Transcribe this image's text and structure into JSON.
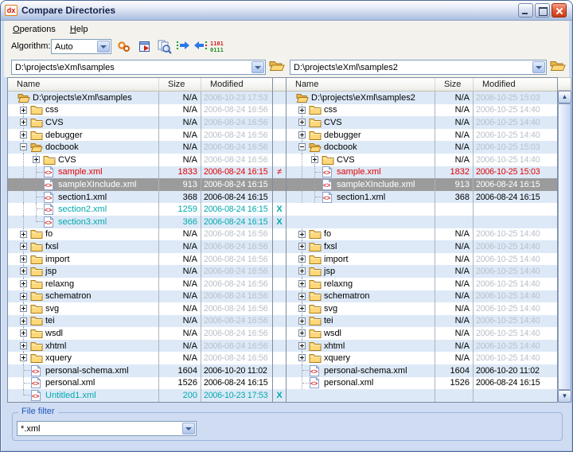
{
  "window": {
    "title": "Compare Directories",
    "icon_text": "dx"
  },
  "menu": {
    "items": [
      "Operations",
      "Help"
    ]
  },
  "toolbar": {
    "algorithm_label": "Algorithm:",
    "algorithm_value": "Auto",
    "icons": [
      "algorithm-options-gears-icon",
      "synchronize-scroll-icon",
      "perform-files-comparison-icon",
      "copy-to-right-icon",
      "copy-to-left-icon",
      "binary-compare-icon"
    ]
  },
  "paths": {
    "left": "D:\\projects\\eXml\\samples",
    "right": "D:\\projects\\eXml\\samples2"
  },
  "columns": [
    "Name",
    "Size",
    "Modified"
  ],
  "rows": [
    {
      "marker": "",
      "cls": "",
      "left": {
        "name": "D:\\projects\\eXml\\samples",
        "size": "N/A",
        "mod": "2006-10-23 17:53",
        "icon": "folder-open",
        "guides": []
      },
      "right": {
        "name": "D:\\projects\\eXml\\samples2",
        "size": "N/A",
        "mod": "2006-10-25 15:03",
        "icon": "folder-open",
        "guides": []
      }
    },
    {
      "marker": "",
      "cls": "",
      "left": {
        "name": "css",
        "size": "N/A",
        "mod": "2006-08-24 16:56",
        "icon": "folder",
        "exp": "+",
        "guides": [
          "boxline"
        ]
      },
      "right": {
        "name": "css",
        "size": "N/A",
        "mod": "2006-10-25 14:40",
        "icon": "folder",
        "exp": "+",
        "guides": [
          "boxline"
        ]
      }
    },
    {
      "marker": "",
      "cls": "",
      "left": {
        "name": "CVS",
        "size": "N/A",
        "mod": "2006-08-24 16:56",
        "icon": "folder",
        "exp": "+",
        "guides": [
          "boxline"
        ]
      },
      "right": {
        "name": "CVS",
        "size": "N/A",
        "mod": "2006-10-25 14:40",
        "icon": "folder",
        "exp": "+",
        "guides": [
          "boxline"
        ]
      }
    },
    {
      "marker": "",
      "cls": "",
      "left": {
        "name": "debugger",
        "size": "N/A",
        "mod": "2006-08-24 16:56",
        "icon": "folder",
        "exp": "+",
        "guides": [
          "boxline"
        ]
      },
      "right": {
        "name": "debugger",
        "size": "N/A",
        "mod": "2006-10-25 14:40",
        "icon": "folder",
        "exp": "+",
        "guides": [
          "boxline"
        ]
      }
    },
    {
      "marker": "",
      "cls": "",
      "left": {
        "name": "docbook",
        "size": "N/A",
        "mod": "2006-08-24 16:56",
        "icon": "folder-open",
        "exp": "-",
        "guides": [
          "boxline"
        ]
      },
      "right": {
        "name": "docbook",
        "size": "N/A",
        "mod": "2006-10-25 15:03",
        "icon": "folder-open",
        "exp": "-",
        "guides": [
          "boxline"
        ]
      }
    },
    {
      "marker": "",
      "cls": "",
      "left": {
        "name": "CVS",
        "size": "N/A",
        "mod": "2006-08-24 16:56",
        "icon": "folder",
        "exp": "+",
        "guides": [
          "line",
          "boxline"
        ]
      },
      "right": {
        "name": "CVS",
        "size": "N/A",
        "mod": "2006-10-25 14:40",
        "icon": "folder",
        "exp": "+",
        "guides": [
          "line",
          "boxline"
        ]
      }
    },
    {
      "marker": "≠",
      "cls": "diff",
      "left": {
        "name": "sample.xml",
        "size": "1833",
        "mod": "2006-08-24 16:15",
        "icon": "xml",
        "guides": [
          "line",
          "stubline"
        ]
      },
      "right": {
        "name": "sample.xml",
        "size": "1832",
        "mod": "2006-10-25 15:03",
        "icon": "xml",
        "guides": [
          "line",
          "stubline"
        ]
      }
    },
    {
      "marker": "",
      "cls": "sel",
      "left": {
        "name": "sampleXInclude.xml",
        "size": "913",
        "mod": "2006-08-24 16:15",
        "icon": "xml",
        "guides": [
          "line",
          "stubline"
        ]
      },
      "right": {
        "name": "sampleXInclude.xml",
        "size": "913",
        "mod": "2006-08-24 16:15",
        "icon": "xml",
        "guides": [
          "line",
          "stubline"
        ]
      }
    },
    {
      "marker": "",
      "cls": "",
      "left": {
        "name": "section1.xml",
        "size": "368",
        "mod": "2006-08-24 16:15",
        "icon": "xml",
        "guides": [
          "line",
          "stubline"
        ]
      },
      "right": {
        "name": "section1.xml",
        "size": "368",
        "mod": "2006-08-24 16:15",
        "icon": "xml",
        "guides": [
          "line",
          "stubline"
        ]
      }
    },
    {
      "marker": "X",
      "cls": "add",
      "left": {
        "name": "section2.xml",
        "size": "1259",
        "mod": "2006-08-24 16:15",
        "icon": "xml",
        "guides": [
          "line",
          "stubline"
        ]
      },
      "right": null
    },
    {
      "marker": "X",
      "cls": "add",
      "left": {
        "name": "section3.xml",
        "size": "366",
        "mod": "2006-08-24 16:15",
        "icon": "xml",
        "guides": [
          "line",
          "stubend"
        ]
      },
      "right": null
    },
    {
      "marker": "",
      "cls": "",
      "left": {
        "name": "fo",
        "size": "N/A",
        "mod": "2006-08-24 16:56",
        "icon": "folder",
        "exp": "+",
        "guides": [
          "boxline"
        ]
      },
      "right": {
        "name": "fo",
        "size": "N/A",
        "mod": "2006-10-25 14:40",
        "icon": "folder",
        "exp": "+",
        "guides": [
          "boxline"
        ]
      }
    },
    {
      "marker": "",
      "cls": "",
      "left": {
        "name": "fxsl",
        "size": "N/A",
        "mod": "2006-08-24 16:56",
        "icon": "folder",
        "exp": "+",
        "guides": [
          "boxline"
        ]
      },
      "right": {
        "name": "fxsl",
        "size": "N/A",
        "mod": "2006-10-25 14:40",
        "icon": "folder",
        "exp": "+",
        "guides": [
          "boxline"
        ]
      }
    },
    {
      "marker": "",
      "cls": "",
      "left": {
        "name": "import",
        "size": "N/A",
        "mod": "2006-08-24 16:56",
        "icon": "folder",
        "exp": "+",
        "guides": [
          "boxline"
        ]
      },
      "right": {
        "name": "import",
        "size": "N/A",
        "mod": "2006-10-25 14:40",
        "icon": "folder",
        "exp": "+",
        "guides": [
          "boxline"
        ]
      }
    },
    {
      "marker": "",
      "cls": "",
      "left": {
        "name": "jsp",
        "size": "N/A",
        "mod": "2006-08-24 16:56",
        "icon": "folder",
        "exp": "+",
        "guides": [
          "boxline"
        ]
      },
      "right": {
        "name": "jsp",
        "size": "N/A",
        "mod": "2006-10-25 14:40",
        "icon": "folder",
        "exp": "+",
        "guides": [
          "boxline"
        ]
      }
    },
    {
      "marker": "",
      "cls": "",
      "left": {
        "name": "relaxng",
        "size": "N/A",
        "mod": "2006-08-24 16:56",
        "icon": "folder",
        "exp": "+",
        "guides": [
          "boxline"
        ]
      },
      "right": {
        "name": "relaxng",
        "size": "N/A",
        "mod": "2006-10-25 14:40",
        "icon": "folder",
        "exp": "+",
        "guides": [
          "boxline"
        ]
      }
    },
    {
      "marker": "",
      "cls": "",
      "left": {
        "name": "schematron",
        "size": "N/A",
        "mod": "2006-08-24 16:56",
        "icon": "folder",
        "exp": "+",
        "guides": [
          "boxline"
        ]
      },
      "right": {
        "name": "schematron",
        "size": "N/A",
        "mod": "2006-10-25 14:40",
        "icon": "folder",
        "exp": "+",
        "guides": [
          "boxline"
        ]
      }
    },
    {
      "marker": "",
      "cls": "",
      "left": {
        "name": "svg",
        "size": "N/A",
        "mod": "2006-08-24 16:56",
        "icon": "folder",
        "exp": "+",
        "guides": [
          "boxline"
        ]
      },
      "right": {
        "name": "svg",
        "size": "N/A",
        "mod": "2006-10-25 14:40",
        "icon": "folder",
        "exp": "+",
        "guides": [
          "boxline"
        ]
      }
    },
    {
      "marker": "",
      "cls": "",
      "left": {
        "name": "tei",
        "size": "N/A",
        "mod": "2006-08-24 16:56",
        "icon": "folder",
        "exp": "+",
        "guides": [
          "boxline"
        ]
      },
      "right": {
        "name": "tei",
        "size": "N/A",
        "mod": "2006-10-25 14:40",
        "icon": "folder",
        "exp": "+",
        "guides": [
          "boxline"
        ]
      }
    },
    {
      "marker": "",
      "cls": "",
      "left": {
        "name": "wsdl",
        "size": "N/A",
        "mod": "2006-08-24 16:56",
        "icon": "folder",
        "exp": "+",
        "guides": [
          "boxline"
        ]
      },
      "right": {
        "name": "wsdl",
        "size": "N/A",
        "mod": "2006-10-25 14:40",
        "icon": "folder",
        "exp": "+",
        "guides": [
          "boxline"
        ]
      }
    },
    {
      "marker": "",
      "cls": "",
      "left": {
        "name": "xhtml",
        "size": "N/A",
        "mod": "2006-08-24 16:56",
        "icon": "folder",
        "exp": "+",
        "guides": [
          "boxline"
        ]
      },
      "right": {
        "name": "xhtml",
        "size": "N/A",
        "mod": "2006-10-25 14:40",
        "icon": "folder",
        "exp": "+",
        "guides": [
          "boxline"
        ]
      }
    },
    {
      "marker": "",
      "cls": "",
      "left": {
        "name": "xquery",
        "size": "N/A",
        "mod": "2006-08-24 16:56",
        "icon": "folder",
        "exp": "+",
        "guides": [
          "boxline"
        ]
      },
      "right": {
        "name": "xquery",
        "size": "N/A",
        "mod": "2006-10-25 14:40",
        "icon": "folder",
        "exp": "+",
        "guides": [
          "boxline"
        ]
      }
    },
    {
      "marker": "",
      "cls": "",
      "left": {
        "name": "personal-schema.xml",
        "size": "1604",
        "mod": "2006-10-20 11:02",
        "icon": "xml",
        "guides": [
          "stubline"
        ]
      },
      "right": {
        "name": "personal-schema.xml",
        "size": "1604",
        "mod": "2006-10-20 11:02",
        "icon": "xml",
        "guides": [
          "stubline"
        ]
      }
    },
    {
      "marker": "",
      "cls": "",
      "left": {
        "name": "personal.xml",
        "size": "1526",
        "mod": "2006-08-24 16:15",
        "icon": "xml",
        "guides": [
          "stubline"
        ]
      },
      "right": {
        "name": "personal.xml",
        "size": "1526",
        "mod": "2006-08-24 16:15",
        "icon": "xml",
        "guides": [
          "stubline"
        ]
      }
    },
    {
      "marker": "X",
      "cls": "add",
      "left": {
        "name": "Untitled1.xml",
        "size": "200",
        "mod": "2006-10-23 17:53",
        "icon": "xml",
        "guides": [
          "stubend"
        ]
      },
      "right": null
    }
  ],
  "file_filter": {
    "label": "File filter",
    "value": "*.xml"
  }
}
